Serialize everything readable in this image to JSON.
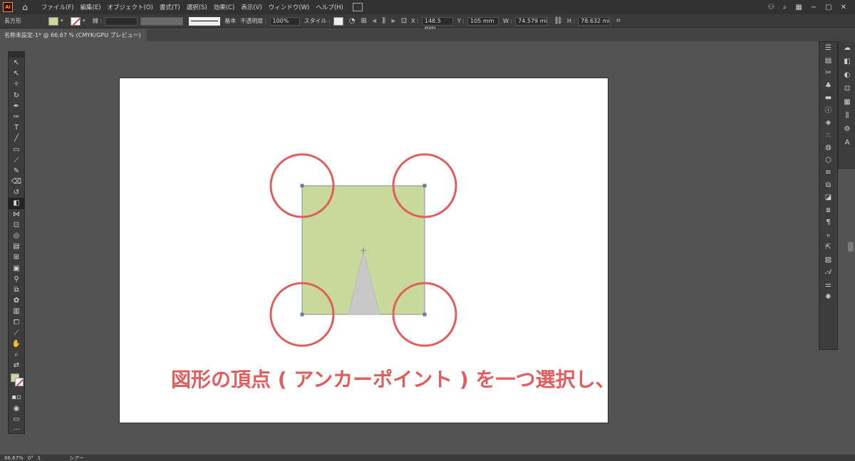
{
  "app": {
    "logo_text": "Ai"
  },
  "menu": {
    "items": [
      "ファイル(F)",
      "編集(E)",
      "オブジェクト(O)",
      "書式(T)",
      "選択(S)",
      "効果(C)",
      "表示(V)",
      "ウィンドウ(W)",
      "ヘルプ(H)"
    ]
  },
  "control": {
    "object_type": "長方形",
    "stroke_label": "線 :",
    "stroke_profile": "基本",
    "opacity_label": "不透明度 :",
    "opacity_value": "100%",
    "style_label": "スタイル :",
    "x_label": "X :",
    "x_value": "148.5 mm",
    "y_label": "Y :",
    "y_value": "105 mm",
    "w_label": "W :",
    "w_value": "74.579 mi",
    "h_label": "H :",
    "h_value": "78.632 mi"
  },
  "document": {
    "tab_title": "名称未設定-1* @ 66.67 % (CMYK/GPU プレビュー)"
  },
  "colors": {
    "fill": "#c9d99c",
    "triangle": "#c8c8c8",
    "highlight_circle": "#e05e5e",
    "anchor": "#6a7a9a"
  },
  "caption": {
    "text": "図形の頂点 ( アンカーポイント ) を一つ選択し、"
  },
  "status": {
    "zoom": "66.67%",
    "rotation": "0°",
    "artboard_num": "1",
    "tool_name": "シアー"
  }
}
